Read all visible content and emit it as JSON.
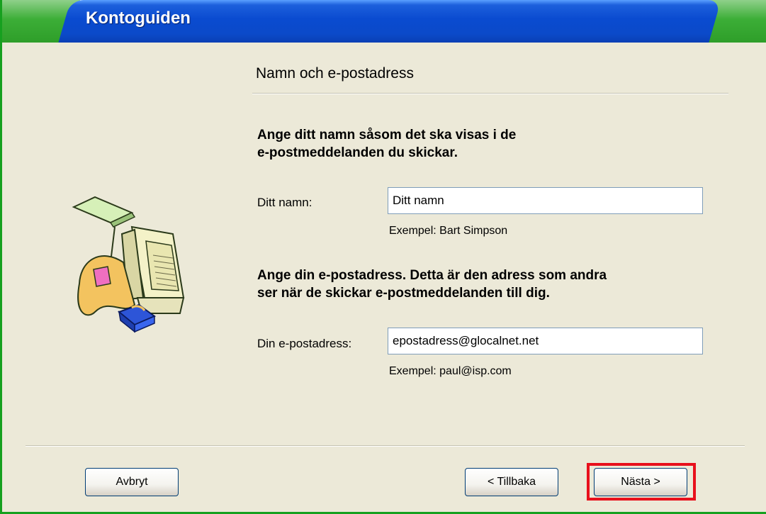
{
  "window": {
    "title": "Kontoguiden"
  },
  "page": {
    "heading": "Namn och e-postadress",
    "name_section": {
      "intro_line1": "Ange ditt namn såsom det ska visas i de",
      "intro_line2": "e-postmeddelanden du skickar.",
      "label": "Ditt namn:",
      "value": "Ditt namn",
      "example": "Exempel: Bart Simpson"
    },
    "email_section": {
      "intro_line1": "Ange din e-postadress. Detta är den adress som andra",
      "intro_line2": "ser när de skickar e-postmeddelanden till dig.",
      "label": "Din e-postadress:",
      "value": "epostadress@glocalnet.net",
      "example": "Exempel: paul@isp.com"
    }
  },
  "buttons": {
    "cancel": "Avbryt",
    "back": "< Tillbaka",
    "next": "Nästa >"
  },
  "colors": {
    "title_bar": "#0a4bd0",
    "window_body": "#ece9d8",
    "highlight": "#e8101c"
  }
}
